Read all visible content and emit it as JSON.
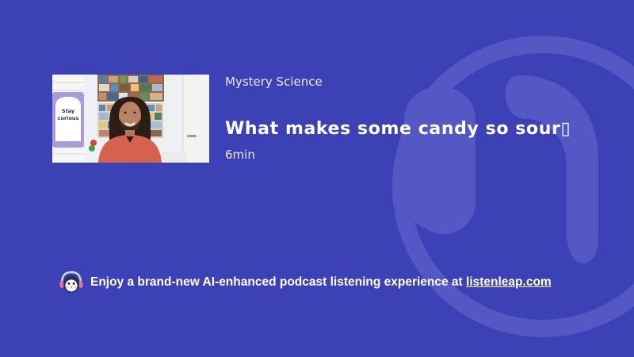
{
  "episode": {
    "channel": "Mystery Science",
    "title": "What makes some candy so sour",
    "title_trailing_glyph": "▯",
    "duration": "6min"
  },
  "thumbnail": {
    "sign_text": [
      "Stay",
      "curious"
    ]
  },
  "promo": {
    "text": "Enjoy a brand-new AI-enhanced podcast listening experience at ",
    "link_text": "listenleap.com"
  },
  "icons": {
    "promo_icon": "penguin-headphones-icon",
    "watermark": "headphones-watermark-icon"
  },
  "colors": {
    "background": "#3d41b6",
    "watermark": "#5a5ec7",
    "text": "#ffffff"
  }
}
